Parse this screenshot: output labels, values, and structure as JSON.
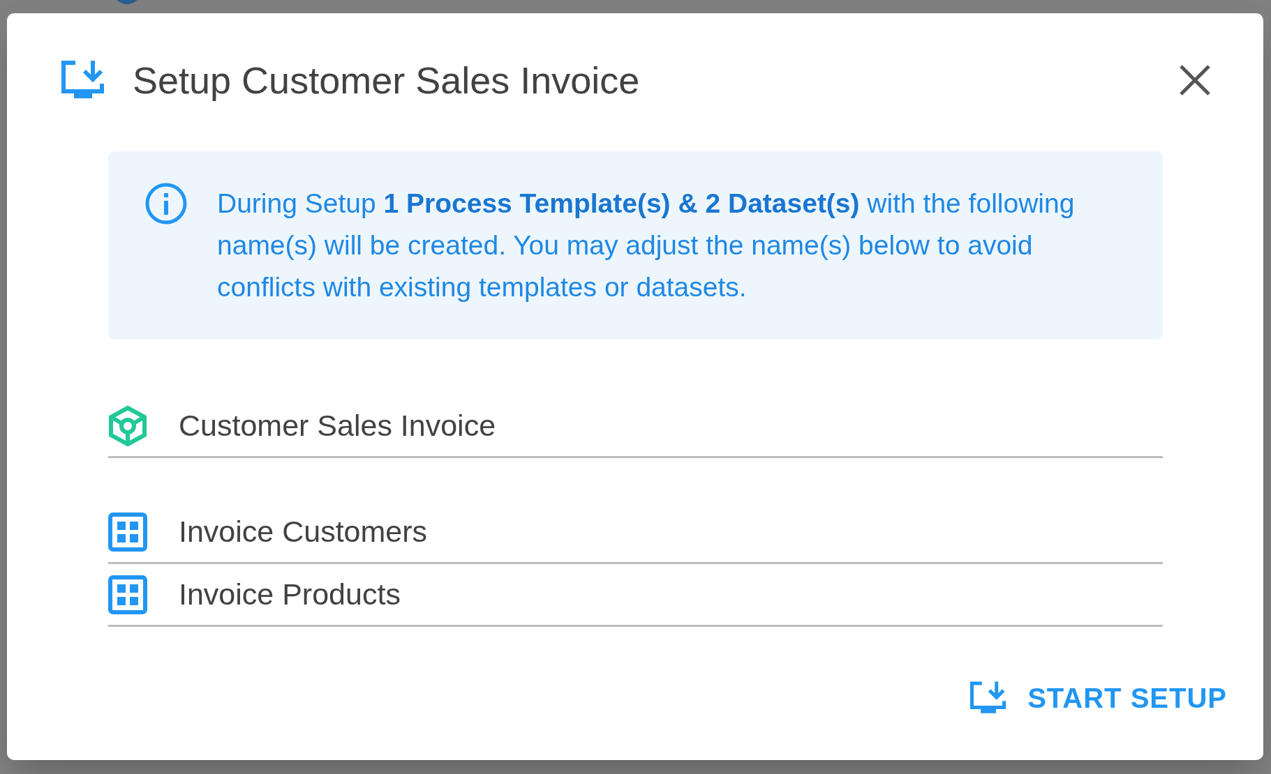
{
  "dialog": {
    "title": "Setup Customer Sales Invoice",
    "info": "During Setup **1 Process Template(s) & 2 Dataset(s)** with the following name(s) will be created. You may adjust the name(s) below to avoid conflicts with existing templates or datasets.",
    "fields": [
      {
        "kind": "template",
        "value": "Customer Sales Invoice"
      },
      {
        "kind": "dataset",
        "value": "Invoice Customers"
      },
      {
        "kind": "dataset",
        "value": "Invoice Products"
      }
    ],
    "button": "START SETUP"
  }
}
